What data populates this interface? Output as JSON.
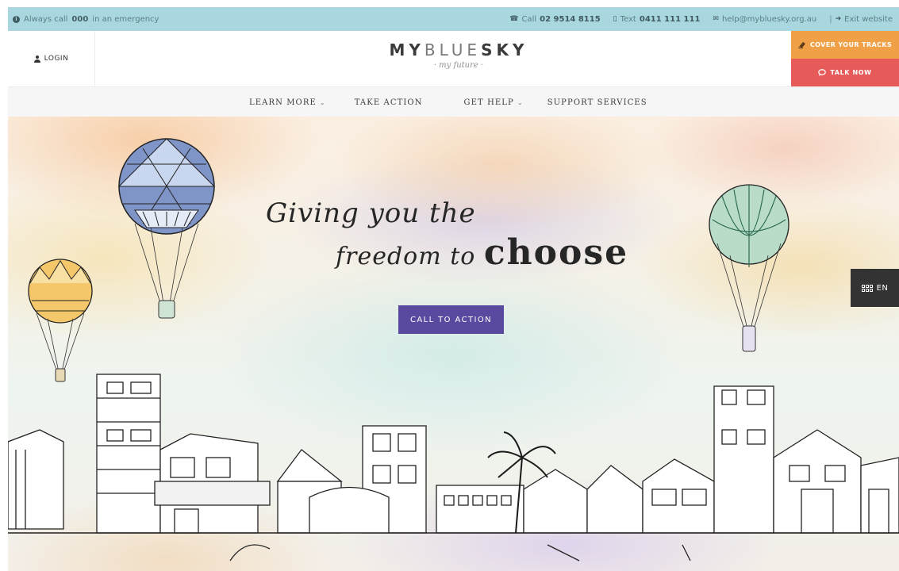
{
  "topbar": {
    "emergency_prefix": "Always call",
    "emergency_number": "000",
    "emergency_suffix": "in an emergency",
    "call_prefix": "Call",
    "call_number": "02 9514 8115",
    "text_prefix": "Text",
    "text_number": "0411 111 111",
    "email": "help@mybluesky.org.au",
    "exit_label": "Exit website"
  },
  "header": {
    "login_label": "LOGIN",
    "logo_my": "MY",
    "logo_blue": "BLUE",
    "logo_sky": "SKY",
    "tagline": "· my future ·",
    "cover_tracks_label": "COVER YOUR TRACKS",
    "talk_now_label": "TALK NOW"
  },
  "nav": {
    "items": [
      {
        "label": "LEARN MORE",
        "has_dropdown": true
      },
      {
        "label": "TAKE ACTION",
        "has_dropdown": false
      },
      {
        "label": "GET HELP",
        "has_dropdown": true
      },
      {
        "label": "SUPPORT SERVICES",
        "has_dropdown": false
      }
    ],
    "dropdown_glyph": "⌄"
  },
  "hero": {
    "headline_line1": "Giving you the",
    "headline_line2_prefix": "freedom to",
    "headline_line2_emphasis": "choose",
    "cta_label": "CALL TO ACTION",
    "language_label": "EN"
  },
  "colors": {
    "topbar_bg": "#a9d7e0",
    "cover_tracks_bg": "#f0a046",
    "talk_now_bg": "#e65a5a",
    "cta_bg": "#5a4a9f",
    "language_bg": "#333333"
  },
  "icons": {
    "emergency": "info-circle-icon",
    "call": "phone-icon",
    "text": "mobile-icon",
    "email": "envelope-icon",
    "exit": "sign-out-icon",
    "login": "user-icon",
    "cover_tracks": "eraser-icon",
    "talk_now": "chat-bubble-icon",
    "language": "translate-grid-icon"
  }
}
